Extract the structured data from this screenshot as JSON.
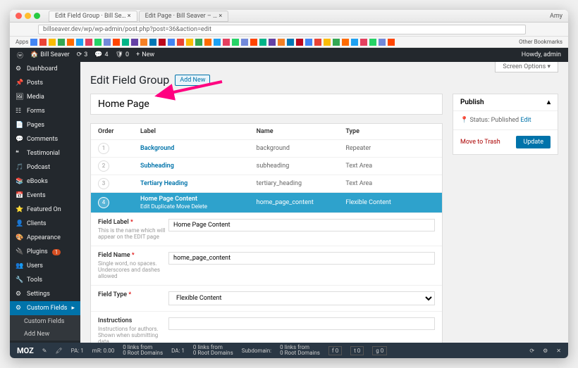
{
  "browser": {
    "tab1": "Edit Field Group · Bill Se…",
    "tab2": "Edit Page · Bill Seaver – …",
    "url": "billseaver.dev/wp/wp-admin/post.php?post=36&action=edit",
    "apps": "Apps",
    "other_bm": "Other Bookmarks",
    "profile": "Amy"
  },
  "adminbar": {
    "site": "Bill Seaver",
    "updates": "3",
    "comments": "4",
    "notifs": "0",
    "new": "New",
    "howdy": "Howdy, admin"
  },
  "sidebar": {
    "items": [
      {
        "label": "Dashboard"
      },
      {
        "label": "Posts"
      },
      {
        "label": "Media"
      },
      {
        "label": "Forms"
      },
      {
        "label": "Pages"
      },
      {
        "label": "Comments"
      },
      {
        "label": "Testimonial"
      },
      {
        "label": "Podcast"
      },
      {
        "label": "eBooks"
      },
      {
        "label": "Events"
      },
      {
        "label": "Featured On"
      },
      {
        "label": "Clients"
      },
      {
        "label": "Appearance"
      },
      {
        "label": "Plugins"
      },
      {
        "label": "Users"
      },
      {
        "label": "Tools"
      },
      {
        "label": "Settings"
      },
      {
        "label": "Custom Fields"
      }
    ],
    "sub1": "Custom Fields",
    "sub2": "Add New",
    "plugin_count": "1"
  },
  "page": {
    "screen_options": "Screen Options",
    "title": "Edit Field Group",
    "add_new": "Add New",
    "group_title": "Home Page"
  },
  "table": {
    "h_order": "Order",
    "h_label": "Label",
    "h_name": "Name",
    "h_type": "Type",
    "rows": [
      {
        "order": "1",
        "label": "Background",
        "name": "background",
        "type": "Repeater"
      },
      {
        "order": "2",
        "label": "Subheading",
        "name": "subheading",
        "type": "Text Area"
      },
      {
        "order": "3",
        "label": "Tertiary Heading",
        "name": "tertiary_heading",
        "type": "Text Area"
      },
      {
        "order": "4",
        "label": "Home Page Content",
        "name": "home_page_content",
        "type": "Flexible Content"
      }
    ],
    "row_actions": "Edit   Duplicate   Move   Delete"
  },
  "form": {
    "field_label": {
      "lbl": "Field Label",
      "desc": "This is the name which will appear on the EDIT page",
      "val": "Home Page Content"
    },
    "field_name": {
      "lbl": "Field Name",
      "desc": "Single word, no spaces. Underscores and dashes allowed",
      "val": "home_page_content"
    },
    "field_type": {
      "lbl": "Field Type",
      "val": "Flexible Content"
    },
    "instructions": {
      "lbl": "Instructions",
      "desc": "Instructions for authors. Shown when submitting data"
    }
  },
  "publish": {
    "title": "Publish",
    "status_lbl": "Status:",
    "status_val": "Published",
    "edit": "Edit",
    "trash": "Move to Trash",
    "update": "Update"
  },
  "moz": {
    "pa": "PA: 1",
    "mr": "mR: 0.00",
    "links1a": "0 links from",
    "links1b": "0 Root Domains",
    "da": "DA: 1",
    "links2a": "0 links from",
    "links2b": "0 Root Domains",
    "sub": "Subdomain:",
    "links3a": "0 links from",
    "links3b": "0 Root Domains",
    "fb": "0",
    "tw": "0",
    "gp": "0"
  }
}
